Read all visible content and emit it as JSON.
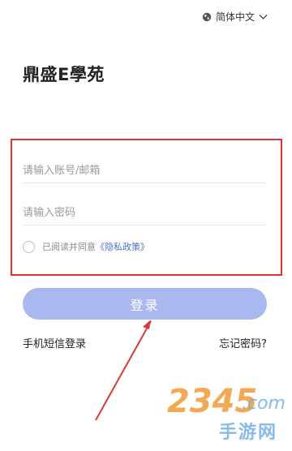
{
  "header": {
    "language": "简体中文",
    "language_icon": "globe-icon",
    "dropdown_icon": "chevron-down-icon"
  },
  "app": {
    "title": "鼎盛E學苑"
  },
  "form": {
    "account_placeholder": "请输入账号/邮箱",
    "account_value": "",
    "password_placeholder": "请输入密码",
    "password_value": "",
    "agreement_text": "已阅读并同意",
    "privacy_link": "《隐私政策》",
    "agreement_checked": false
  },
  "actions": {
    "login_label": "登录",
    "sms_login_label": "手机短信登录",
    "forgot_password_label": "忘记密码?"
  },
  "watermark": {
    "logo_text": "2345.com",
    "site_text": "手游网"
  },
  "colors": {
    "highlight_border": "#e23131",
    "login_button": "#a9b8ee",
    "link": "#4a73c9",
    "annotation_arrow": "#d93a3a",
    "watermark_orange": "#f29a36",
    "watermark_blue": "#6fb0e8"
  }
}
